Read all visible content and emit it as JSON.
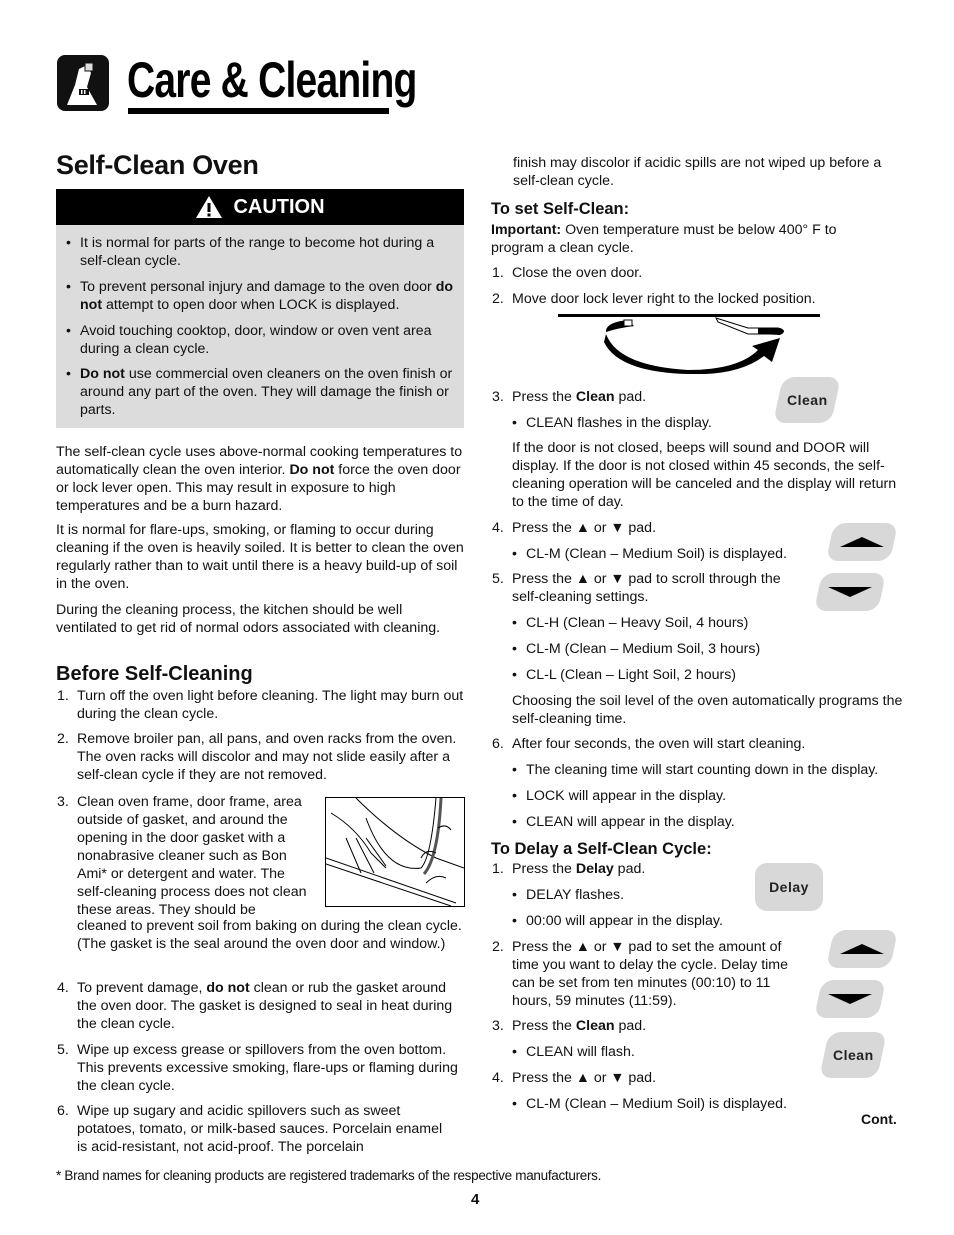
{
  "header": {
    "title": "Care & Cleaning",
    "icon": "spray-bottle-icon"
  },
  "section": {
    "title": "Self-Clean Oven"
  },
  "caution": {
    "label": "CAUTION",
    "icon": "warning-triangle-icon",
    "items": [
      {
        "bold": "",
        "text": "It is normal for parts of the range to become hot during a self-clean cycle."
      },
      {
        "pre": "To prevent personal injury and damage to the oven door ",
        "bold": "do not",
        "text": " attempt to open door when LOCK is displayed."
      },
      {
        "bold": "",
        "text": "Avoid touching cooktop, door, window or oven vent area during a clean cycle."
      },
      {
        "bold": "Do not",
        "text": " use commercial oven cleaners on the oven finish or around any part of the oven.  They will damage the finish or parts."
      }
    ]
  },
  "intro": [
    {
      "pre": "The self-clean cycle uses above-normal cooking temperatures to automatically clean the oven interior. ",
      "bold": "Do not",
      "post": " force the oven door or lock lever open. This may result in exposure to high temperatures and be a burn hazard."
    },
    {
      "text": "It is normal for flare-ups, smoking, or flaming to occur during cleaning if the oven is heavily soiled.  It is better to clean the oven regularly rather than to wait until there is a heavy build-up of soil in the oven."
    },
    {
      "text": "During the cleaning process, the kitchen should be well ventilated to get rid of normal odors associated with cleaning."
    }
  ],
  "before": {
    "title": "Before Self-Cleaning",
    "steps": [
      {
        "n": "1.",
        "text": "Turn off the oven light before cleaning.  The light may burn out during the clean cycle."
      },
      {
        "n": "2.",
        "text": "Remove broiler pan, all pans, and oven racks from the oven.  The oven racks will discolor and may not slide easily after a self-clean cycle if they are not removed."
      },
      {
        "n": "3.",
        "text_a": "Clean oven frame, door frame, area outside of gasket, and around the opening in the door gasket with a nonabrasive cleaner such as Bon Ami* or detergent and water.  The self-cleaning process does not clean these areas.  They should be",
        "text_b": "cleaned to prevent soil from baking on during the clean cycle.  (The gasket is the seal around the oven door and window.)"
      },
      {
        "n": "4.",
        "pre": "To prevent damage, ",
        "bold": "do not",
        "post": " clean or rub the gasket around the oven door.  The gasket is designed to seal in heat during the clean cycle."
      },
      {
        "n": "5.",
        "text": "Wipe up excess grease or spillovers from the oven bottom. This prevents excessive smoking, flare-ups or flaming during the clean cycle."
      },
      {
        "n": "6.",
        "text": "Wipe up sugary and acidic spillovers such as sweet potatoes, tomato, or milk-based sauces.  Porcelain enamel is acid-resistant, not acid-proof.  The porcelain",
        "cont": "finish may discolor if acidic spills are not wiped up before a self-clean cycle."
      }
    ],
    "illustration": "hand-cleaning-oven-frame-illustration"
  },
  "set_clean": {
    "title": "To set Self-Clean:",
    "important_label": "Important:",
    "important_text": " Oven temperature must be below 400° F to program a clean cycle.",
    "step1": {
      "n": "1.",
      "text": "Close the oven door."
    },
    "step2": {
      "n": "2.",
      "text": "Move door lock lever right to the locked position."
    },
    "step3": {
      "n": "3.",
      "pre": "Press the ",
      "bold": "Clean",
      "post": " pad."
    },
    "step3_bullet": "CLEAN flashes in the display.",
    "step3_note": "If the door is not closed, beeps will sound and DOOR will display.  If the door is not closed within 45 seconds, the self-cleaning operation will be canceled and the display will return to the time of day.",
    "step4": {
      "n": "4.",
      "text": "Press the ▲ or ▼ pad."
    },
    "step4_bullet": "CL-M (Clean – Medium Soil) is displayed.",
    "step5": {
      "n": "5.",
      "text": "Press the ▲ or ▼ pad to scroll through the self-cleaning settings."
    },
    "step5_bullets": [
      "CL-H (Clean – Heavy Soil, 4 hours)",
      "CL-M (Clean – Medium Soil, 3 hours)",
      "CL-L (Clean – Light Soil, 2 hours)"
    ],
    "step5_note": "Choosing the soil level of the oven automatically programs the self-cleaning time.",
    "step6": {
      "n": "6.",
      "text": "After four seconds, the oven will start cleaning."
    },
    "step6_bullets": [
      "The cleaning time will start counting down in the display.",
      "LOCK will appear in the display.",
      "CLEAN will appear in the display."
    ]
  },
  "delay": {
    "title": "To Delay a Self-Clean Cycle:",
    "step1": {
      "n": "1.",
      "pre": "Press the ",
      "bold": "Delay",
      "post": " pad."
    },
    "step1_bullets": [
      "DELAY flashes.",
      "00:00 will appear in the display."
    ],
    "step2": {
      "n": "2.",
      "text": "Press the ▲ or ▼ pad to set the amount of time you want to delay the cycle. Delay time can be set from ten minutes (00:10) to 11 hours, 59 minutes (11:59)."
    },
    "step3": {
      "n": "3.",
      "pre": "Press the ",
      "bold": "Clean",
      "post": " pad."
    },
    "step3_bullet": "CLEAN will flash.",
    "step4": {
      "n": "4.",
      "text": "Press the ▲ or ▼ pad."
    },
    "step4_bullet": "CL-M (Clean – Medium Soil) is displayed."
  },
  "pads": {
    "clean": "Clean",
    "delay": "Delay"
  },
  "cont_label": "Cont.",
  "footnote": "* Brand names for cleaning products are registered trademarks of the respective manufacturers.",
  "page_number": "4"
}
